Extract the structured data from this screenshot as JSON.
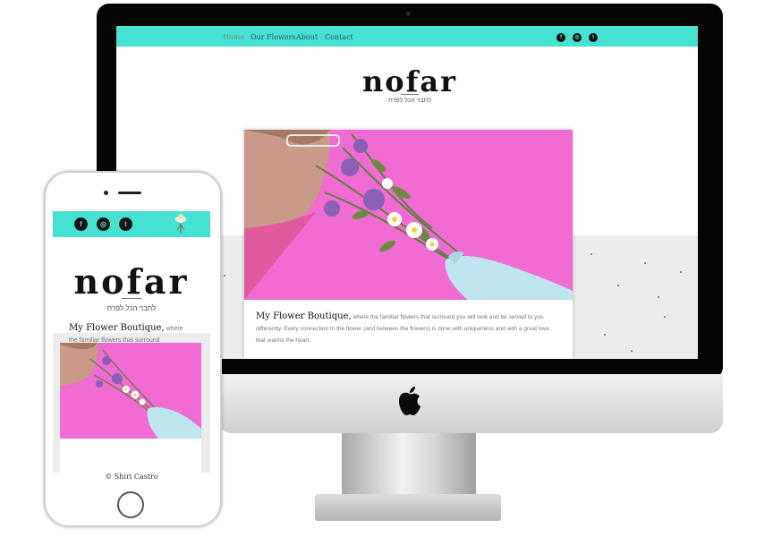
{
  "desktop": {
    "nav": {
      "links": [
        "Home",
        "Our Flowers",
        "About",
        "Contact"
      ],
      "social": [
        "facebook-icon",
        "instagram-icon",
        "twitter-icon"
      ]
    },
    "logo": {
      "name": "nofar",
      "tagline": "לחבר הכל לפרח"
    },
    "card": {
      "heading": "My Flower Boutique,",
      "body": " where the familiar flowers that surround you will look and be served to you differently. Every connection to the flower (and between the flowers) is done with uniqueness and with a great love that warms the heart."
    }
  },
  "mobile": {
    "nav": {
      "social": [
        "facebook-icon",
        "instagram-icon",
        "twitter-icon"
      ]
    },
    "logo": {
      "name": "nofar",
      "tagline": "לחבר הכל לפרח"
    },
    "card": {
      "heading": "My Flower Boutique,",
      "body": " where the familiar flowers that surround"
    },
    "footer": {
      "copyright": "© Shiri Castro"
    }
  },
  "colors": {
    "accent": "#45e2d4",
    "photo_background": "#f06bd2",
    "bezel": "#050505",
    "section_grey": "#ececec"
  }
}
